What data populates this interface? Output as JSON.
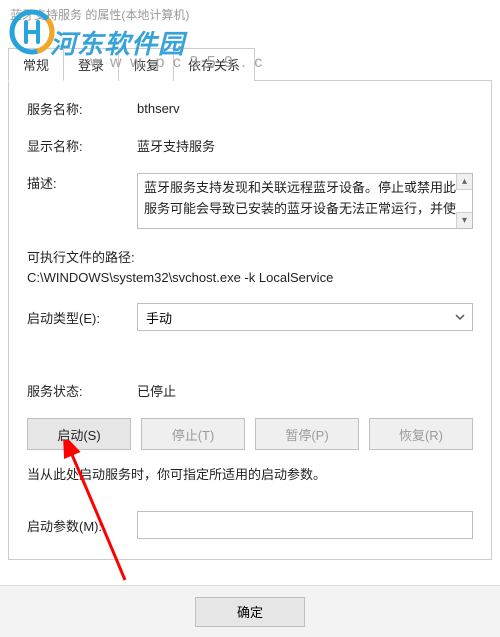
{
  "window_title": "蓝牙支持服务 的属性(本地计算机)",
  "watermark": {
    "brand": "河东软件园",
    "url": "w w w. p c 3 5 9 . c"
  },
  "tabs": {
    "general": "常规",
    "logon": "登录",
    "recovery": "恢复",
    "deps": "依存关系"
  },
  "labels": {
    "service_name": "服务名称:",
    "display_name": "显示名称:",
    "description": "描述:",
    "exec_path": "可执行文件的路径:",
    "startup_type": "启动类型(E):",
    "service_status": "服务状态:",
    "hint": "当从此处启动服务时，你可指定所适用的启动参数。",
    "start_params": "启动参数(M):"
  },
  "values": {
    "service_name": "bthserv",
    "display_name": "蓝牙支持服务",
    "description": "蓝牙服务支持发现和关联远程蓝牙设备。停止或禁用此服务可能会导致已安装的蓝牙设备无法正常运行，并使",
    "exec_path": "C:\\WINDOWS\\system32\\svchost.exe -k LocalService",
    "startup_type": "手动",
    "service_status": "已停止",
    "start_params": ""
  },
  "buttons": {
    "start": "启动(S)",
    "stop": "停止(T)",
    "pause": "暂停(P)",
    "resume": "恢复(R)",
    "ok": "确定"
  }
}
